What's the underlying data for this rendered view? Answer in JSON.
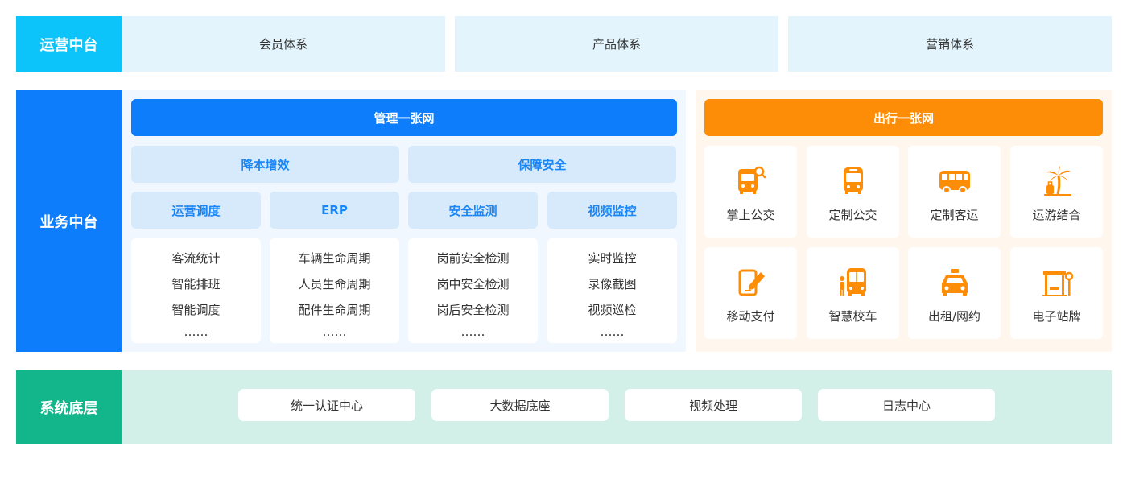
{
  "ops_layer": {
    "label": "运营中台",
    "items": [
      "会员体系",
      "产品体系",
      "营销体系"
    ]
  },
  "business_layer": {
    "label": "业务中台",
    "management": {
      "title": "管理一张网",
      "goals": [
        "降本增效",
        "保障安全"
      ],
      "categories": [
        {
          "title": "运营调度",
          "items": [
            "客流统计",
            "智能排班",
            "智能调度",
            "……"
          ]
        },
        {
          "title": "ERP",
          "items": [
            "车辆生命周期",
            "人员生命周期",
            "配件生命周期",
            "……"
          ]
        },
        {
          "title": "安全监测",
          "items": [
            "岗前安全检测",
            "岗中安全检测",
            "岗后安全检测",
            "……"
          ]
        },
        {
          "title": "视频监控",
          "items": [
            "实时监控",
            "录像截图",
            "视频巡检",
            "……"
          ]
        }
      ]
    },
    "travel": {
      "title": "出行一张网",
      "services": [
        {
          "label": "掌上公交",
          "icon": "bus-search-icon"
        },
        {
          "label": "定制公交",
          "icon": "bus-front-icon"
        },
        {
          "label": "定制客运",
          "icon": "coach-icon"
        },
        {
          "label": "运游结合",
          "icon": "palm-tree-luggage-icon"
        },
        {
          "label": "移动支付",
          "icon": "phone-pen-icon"
        },
        {
          "label": "智慧校车",
          "icon": "school-bus-icon"
        },
        {
          "label": "出租/网约",
          "icon": "taxi-icon"
        },
        {
          "label": "电子站牌",
          "icon": "bus-stop-icon"
        }
      ]
    }
  },
  "base_layer": {
    "label": "系统底层",
    "items": [
      "统一认证中心",
      "大数据底座",
      "视频处理",
      "日志中心"
    ]
  },
  "colors": {
    "ops_label": "#0cc4fa",
    "business_label": "#0d7dfb",
    "base_label": "#13b68b",
    "travel_orange": "#fd8c07",
    "accent_blue": "#1a85f5"
  }
}
